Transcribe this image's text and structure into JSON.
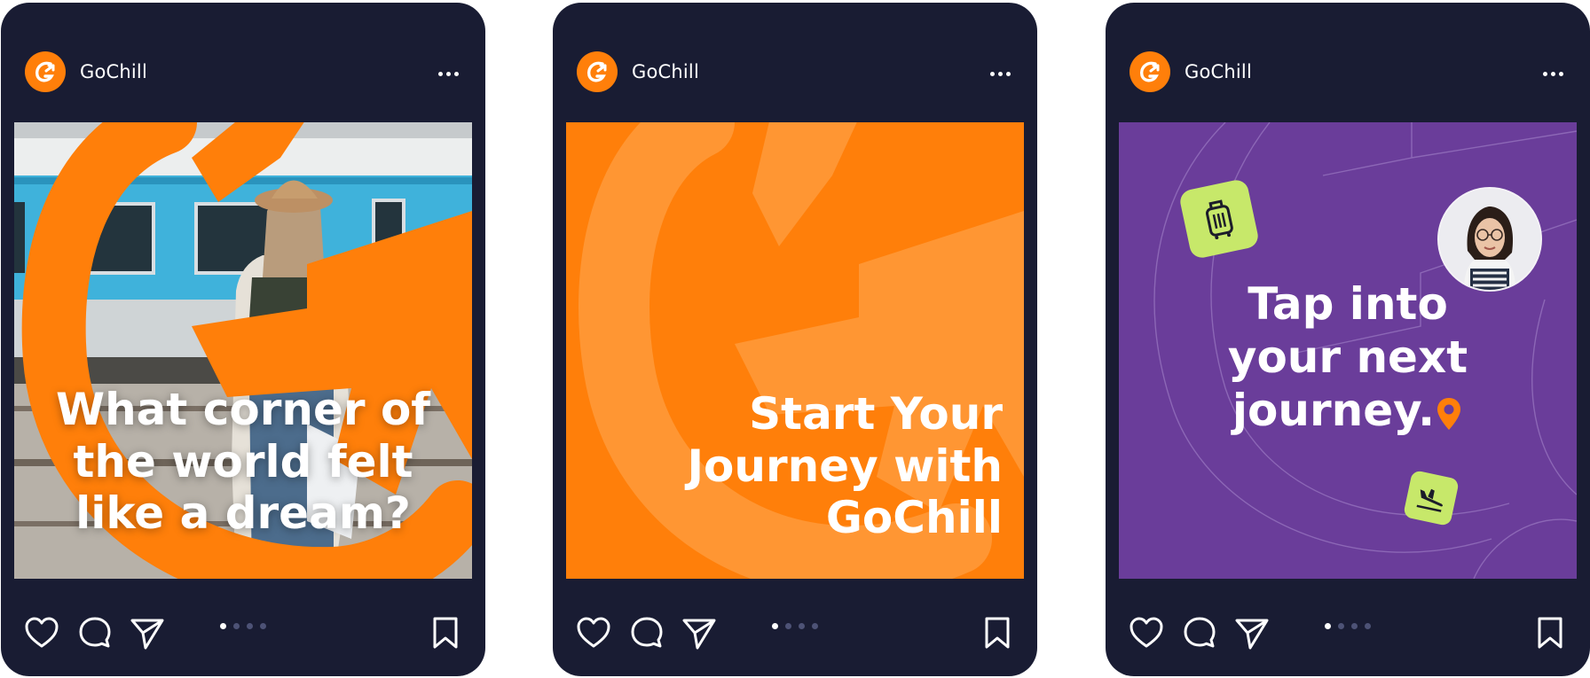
{
  "posts": [
    {
      "account": "GoChill",
      "lines": [
        "What corner of",
        "the world felt",
        "like a dream?"
      ],
      "slide_count": 4,
      "active_slide": 1
    },
    {
      "account": "GoChill",
      "lines": [
        "Start Your",
        "Journey with",
        "GoChill"
      ],
      "slide_count": 4,
      "active_slide": 1
    },
    {
      "account": "GoChill",
      "lines": [
        "Tap into",
        "your next",
        "journey."
      ],
      "slide_count": 4,
      "active_slide": 1
    }
  ],
  "icons": {
    "avatar": "gochill-logo-icon",
    "more": "more-options-icon",
    "like": "heart-icon",
    "comment": "comment-icon",
    "share": "send-icon",
    "save": "bookmark-icon",
    "sticker_1": "luggage-icon",
    "sticker_2": "airplane-landing-icon",
    "location": "location-pin-icon"
  },
  "colors": {
    "card_bg": "#191c33",
    "brand_orange": "#ff7f0a",
    "purple": "#6a3d9a",
    "lime": "#c7e86a",
    "white": "#ffffff"
  }
}
